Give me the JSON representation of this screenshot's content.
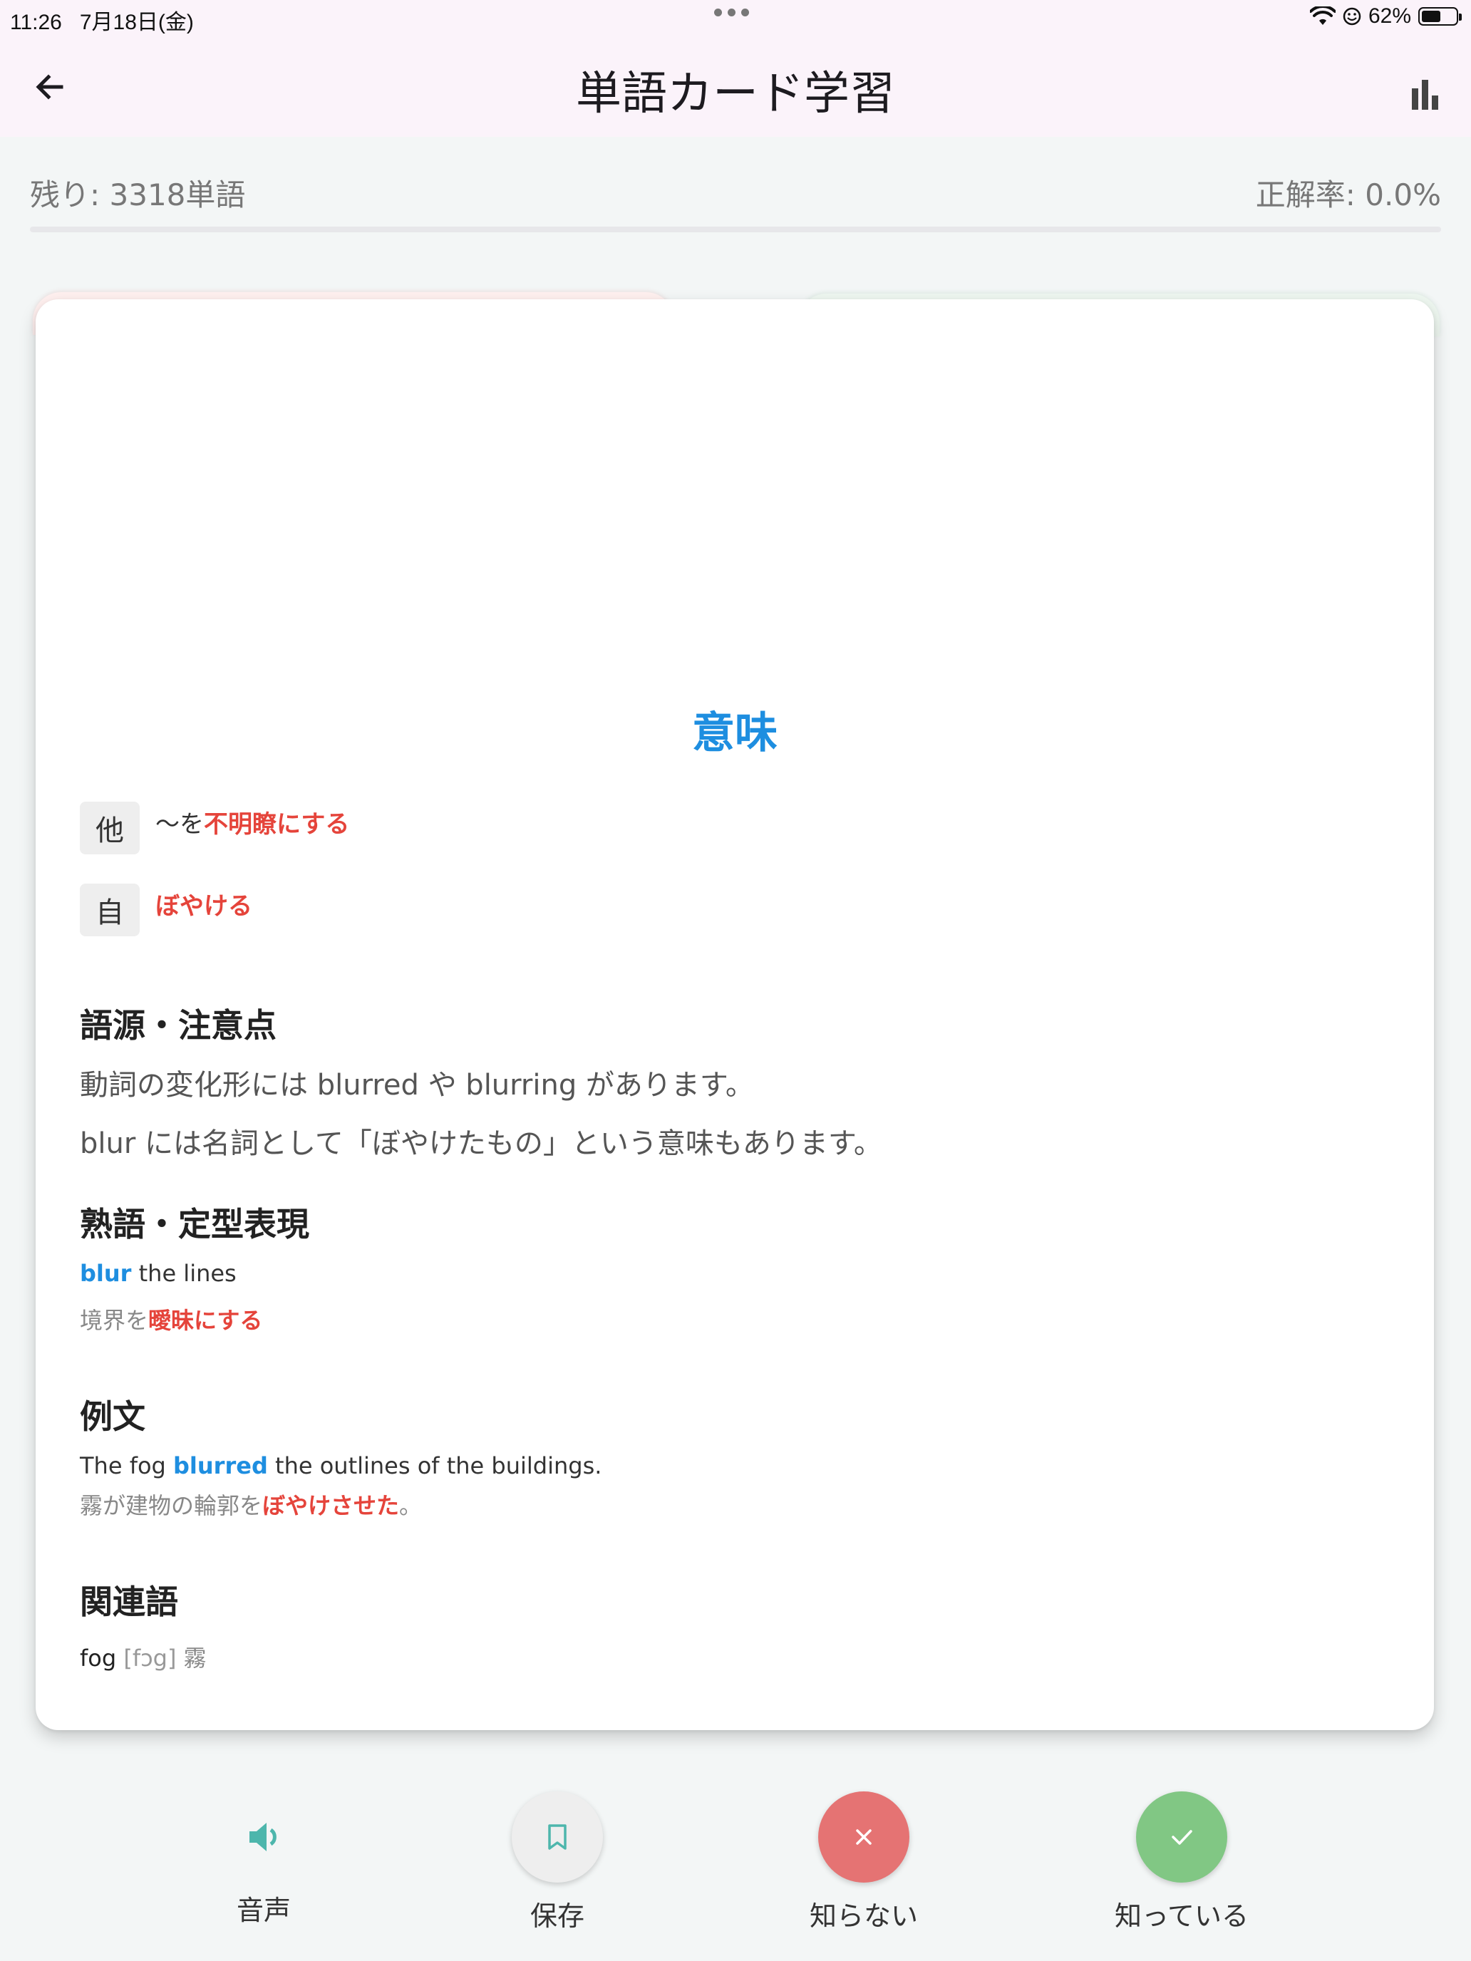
{
  "status_bar": {
    "time": "11:26",
    "date": "7月18日(金)",
    "battery": "62%",
    "battery_level": 0.62
  },
  "app_bar": {
    "title": "単語カード学習"
  },
  "progress": {
    "remaining": "残り: 3318単語",
    "accuracy": "正解率: 0.0%",
    "fraction": 0.0
  },
  "card": {
    "meaning_title": "意味",
    "definitions": [
      {
        "pos": "他",
        "prefix": "〜を",
        "highlight": "不明瞭にする"
      },
      {
        "pos": "自",
        "prefix": "",
        "highlight": "ぼやける"
      }
    ],
    "etymology": {
      "title": "語源・注意点",
      "lines": [
        "動詞の変化形には blurred や blurring があります。",
        "blur には名詞として「ぼやけたもの」という意味もあります。"
      ]
    },
    "idioms": {
      "title": "熟語・定型表現",
      "phrase_highlight": "blur",
      "phrase_rest": " the lines",
      "translation_prefix": "境界を",
      "translation_highlight": "曖昧にする"
    },
    "examples": {
      "title": "例文",
      "sentence_before": "The fog ",
      "sentence_highlight": "blurred",
      "sentence_after": " the outlines of the buildings.",
      "translation_prefix": "霧が建物の輪郭を",
      "translation_highlight": "ぼやけさせた",
      "translation_suffix": "。"
    },
    "related": {
      "title": "関連語",
      "word": "fog",
      "pronunciation": "[fɔg]",
      "meaning": "霧"
    }
  },
  "controls": {
    "audio_label": "音声",
    "save_label": "保存",
    "unknown_label": "知らない",
    "known_label": "知っている",
    "colors": {
      "audio": "#4db6ac",
      "save_bg": "#eeeeee",
      "unknown_bg": "#e57373",
      "known_bg": "#81c784"
    }
  }
}
